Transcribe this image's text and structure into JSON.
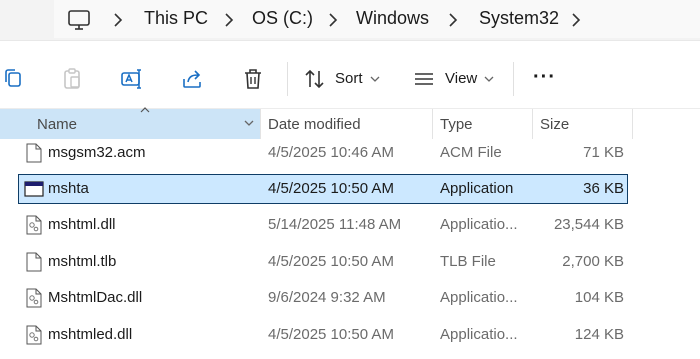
{
  "breadcrumb": {
    "items": [
      "This PC",
      "OS (C:)",
      "Windows",
      "System32"
    ]
  },
  "toolbar": {
    "sort_label": "Sort",
    "view_label": "View",
    "more_label": "···"
  },
  "columns": {
    "name": "Name",
    "date": "Date modified",
    "type": "Type",
    "size": "Size"
  },
  "files": [
    {
      "name": "msgsm32.acm",
      "date": "4/5/2025 10:46 AM",
      "type": "ACM File",
      "size": "71 KB",
      "icon": "file-icon",
      "selected": false
    },
    {
      "name": "mshta",
      "date": "4/5/2025 10:50 AM",
      "type": "Application",
      "size": "36 KB",
      "icon": "application-icon",
      "selected": true
    },
    {
      "name": "mshtml.dll",
      "date": "5/14/2025 11:48 AM",
      "type": "Applicatio...",
      "size": "23,544 KB",
      "icon": "dll-icon",
      "selected": false
    },
    {
      "name": "mshtml.tlb",
      "date": "4/5/2025 10:50 AM",
      "type": "TLB File",
      "size": "2,700 KB",
      "icon": "file-icon",
      "selected": false
    },
    {
      "name": "MshtmlDac.dll",
      "date": "9/6/2024 9:32 AM",
      "type": "Applicatio...",
      "size": "104 KB",
      "icon": "dll-icon",
      "selected": false
    },
    {
      "name": "mshtmled.dll",
      "date": "4/5/2025 10:50 AM",
      "type": "Applicatio...",
      "size": "124 KB",
      "icon": "dll-icon",
      "selected": false
    }
  ],
  "colors": {
    "selection_bg": "#cce8ff",
    "selection_border": "#0f3d66",
    "header_sorted_bg": "#cce4f7"
  }
}
